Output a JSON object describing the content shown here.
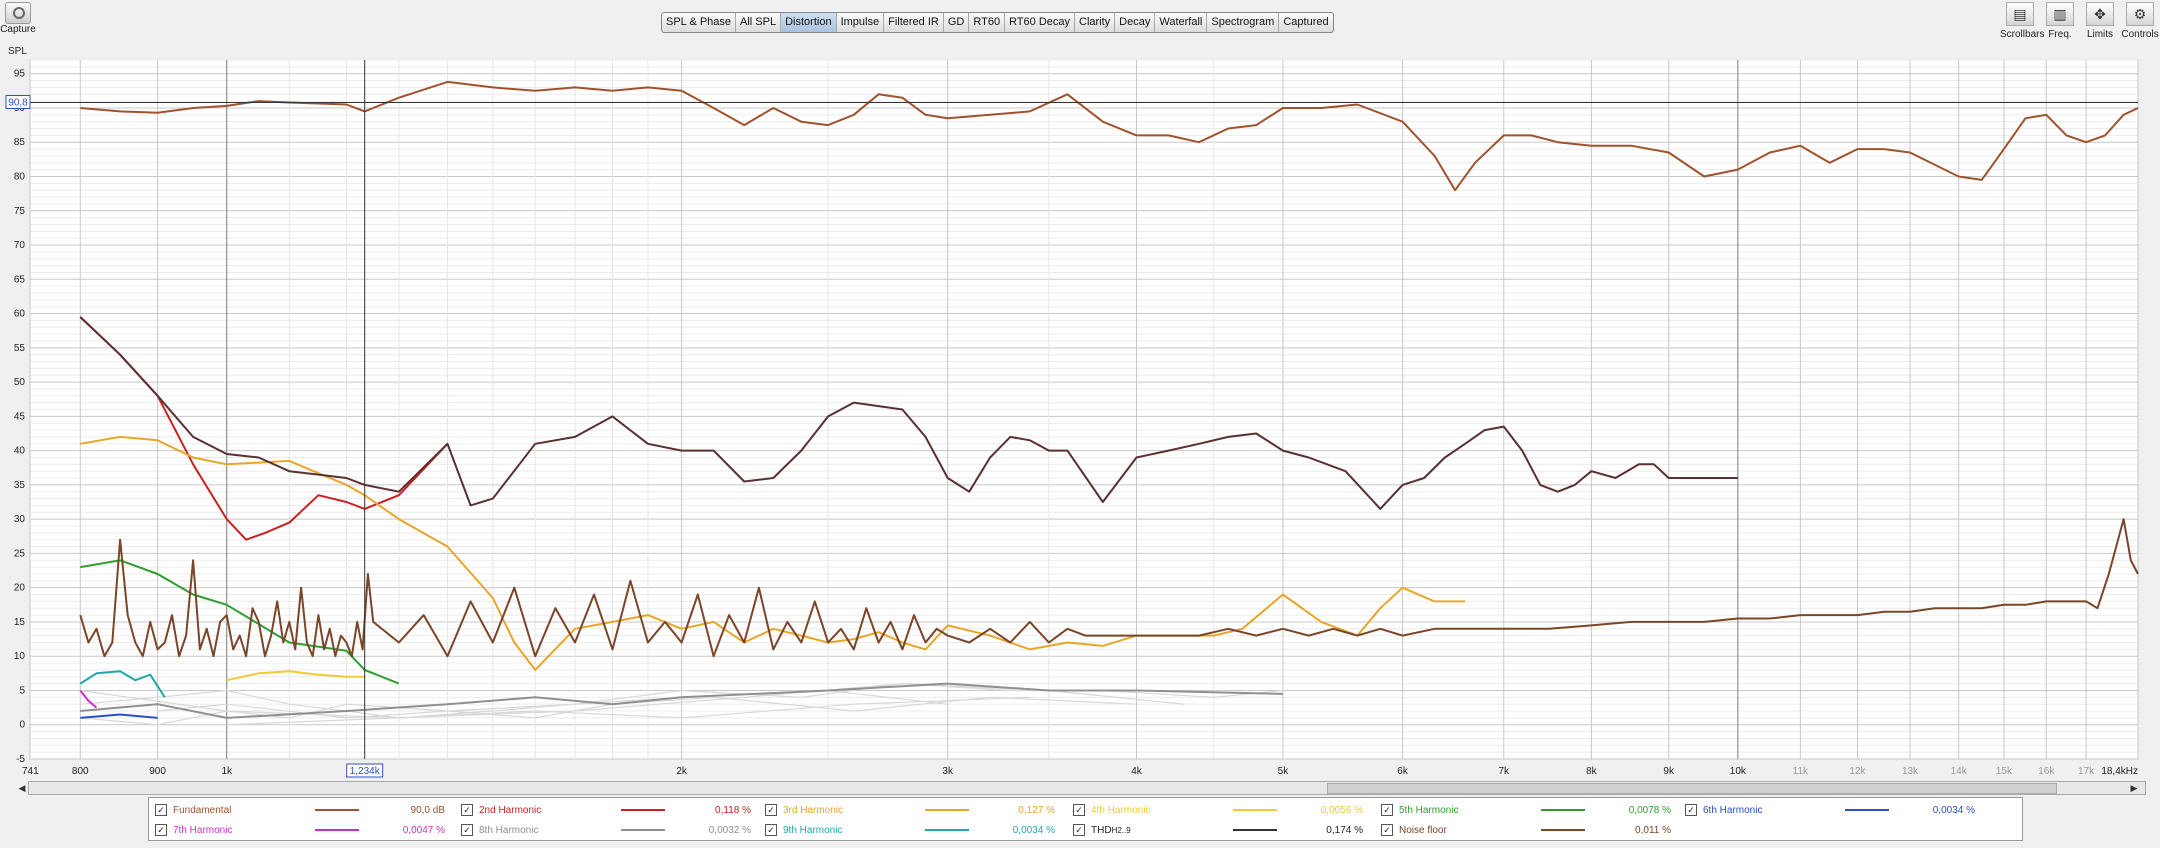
{
  "toolbar": {
    "capture_label": "Capture",
    "tabs": [
      "SPL & Phase",
      "All SPL",
      "Distortion",
      "Impulse",
      "Filtered IR",
      "GD",
      "RT60",
      "RT60 Decay",
      "Clarity",
      "Decay",
      "Waterfall",
      "Spectrogram",
      "Captured"
    ],
    "active_tab": "Distortion",
    "right_buttons": [
      "Scrollbars",
      "Freq. Axis",
      "Limits",
      "Controls"
    ]
  },
  "chart_data": {
    "type": "line",
    "ylabel": "SPL",
    "ylim": [
      -5,
      97
    ],
    "yticks": [
      95,
      90,
      85,
      80,
      75,
      70,
      65,
      60,
      55,
      50,
      45,
      40,
      35,
      30,
      25,
      20,
      15,
      10,
      5,
      0,
      -5
    ],
    "xscale": "log",
    "xlim": [
      741,
      18400
    ],
    "xticks": [
      {
        "v": 741,
        "t": "741"
      },
      {
        "v": 800,
        "t": "800"
      },
      {
        "v": 900,
        "t": "900"
      },
      {
        "v": 1000,
        "t": "1k"
      },
      {
        "v": 2000,
        "t": "2k"
      },
      {
        "v": 3000,
        "t": "3k"
      },
      {
        "v": 4000,
        "t": "4k"
      },
      {
        "v": 5000,
        "t": "5k"
      },
      {
        "v": 6000,
        "t": "6k"
      },
      {
        "v": 7000,
        "t": "7k"
      },
      {
        "v": 8000,
        "t": "8k"
      },
      {
        "v": 9000,
        "t": "9k"
      },
      {
        "v": 10000,
        "t": "10k"
      },
      {
        "v": 11000,
        "t": "11k"
      },
      {
        "v": 12000,
        "t": "12k"
      },
      {
        "v": 13000,
        "t": "13k"
      },
      {
        "v": 14000,
        "t": "14k"
      },
      {
        "v": 15000,
        "t": "15k"
      },
      {
        "v": 16000,
        "t": "16k"
      },
      {
        "v": 17000,
        "t": "17k"
      },
      {
        "v": 18400,
        "t": "18,4kHz"
      }
    ],
    "cursor_x_label": "1,234k",
    "cursor_x": 1234,
    "cursor_y_label": "90,8",
    "cursor_y": 90.8,
    "series": [
      {
        "name": "Fundamental",
        "color": "#a0522d",
        "x": [
          800,
          850,
          900,
          950,
          1000,
          1050,
          1100,
          1200,
          1234,
          1300,
          1400,
          1500,
          1600,
          1700,
          1800,
          1900,
          2000,
          2100,
          2200,
          2300,
          2400,
          2500,
          2600,
          2700,
          2800,
          2900,
          3000,
          3200,
          3400,
          3600,
          3800,
          4000,
          4200,
          4400,
          4600,
          4800,
          5000,
          5300,
          5600,
          6000,
          6300,
          6500,
          6700,
          7000,
          7300,
          7600,
          8000,
          8500,
          9000,
          9500,
          10000,
          10500,
          11000,
          11500,
          12000,
          12500,
          13000,
          14000,
          14500,
          15000,
          15500,
          16000,
          16500,
          17000,
          17500,
          18000,
          18400
        ],
        "y": [
          90,
          89.5,
          89.3,
          90,
          90.3,
          91,
          90.8,
          90.5,
          89.5,
          91.5,
          93.8,
          93,
          92.5,
          93,
          92.5,
          93,
          92.5,
          90,
          87.5,
          90,
          88,
          87.5,
          89,
          92,
          91.5,
          89,
          88.5,
          89,
          89.5,
          92,
          88,
          86,
          86,
          85,
          87,
          87.5,
          90,
          90,
          90.5,
          88,
          83,
          78,
          82,
          86,
          86,
          85,
          84.5,
          84.5,
          83.5,
          80,
          81,
          83.5,
          84.5,
          82,
          84,
          84,
          83.5,
          80,
          79.5,
          84,
          88.5,
          89,
          86,
          85,
          86,
          89,
          90
        ]
      },
      {
        "name": "2nd Harmonic",
        "color": "#cc2020",
        "x": [
          800,
          850,
          900,
          950,
          1000,
          1030,
          1060,
          1100,
          1150,
          1200,
          1234,
          1300,
          1400
        ],
        "y": [
          59.5,
          54,
          48,
          38,
          30,
          27,
          28,
          29.5,
          33.5,
          32.5,
          31.5,
          33.5,
          41
        ]
      },
      {
        "name": "3rd Harmonic",
        "color": "#e8a628",
        "x": [
          800,
          850,
          900,
          950,
          1000,
          1100,
          1200,
          1234,
          1300,
          1400,
          1500,
          1550,
          1600,
          1700,
          1800,
          1900,
          2000,
          2100,
          2200,
          2300,
          2400,
          2500,
          2600,
          2700,
          2800,
          2900,
          3000,
          3200,
          3400,
          3600,
          3800,
          4000,
          4500,
          4700,
          5000,
          5300,
          5600,
          5800,
          6000,
          6300,
          6600
        ],
        "y": [
          41,
          42,
          41.5,
          39,
          38,
          38.5,
          35,
          33.5,
          30,
          26,
          18.5,
          12,
          8,
          14,
          15,
          16,
          14,
          15,
          12,
          14,
          13,
          12,
          12.5,
          13.5,
          12,
          11,
          14.5,
          13,
          11,
          12,
          11.5,
          13,
          13,
          14,
          19,
          15,
          13,
          17,
          20,
          18,
          18
        ]
      },
      {
        "name": "4th Harmonic",
        "color": "#f0c838",
        "x": [
          1000,
          1050,
          1100,
          1150,
          1200,
          1234
        ],
        "y": [
          6.5,
          7.5,
          7.8,
          7.3,
          7,
          7
        ]
      },
      {
        "name": "5th Harmonic",
        "color": "#2e9e2e",
        "x": [
          800,
          850,
          900,
          950,
          1000,
          1100,
          1200,
          1234,
          1300
        ],
        "y": [
          23,
          24,
          22,
          19,
          17.5,
          12,
          10.8,
          8,
          6
        ]
      },
      {
        "name": "6th Harmonic",
        "color": "#2a50c8",
        "x": [
          800,
          850,
          900
        ],
        "y": [
          1,
          1.5,
          1
        ]
      },
      {
        "name": "7th Harmonic",
        "color": "#cc30cc",
        "x": [
          800,
          810,
          820
        ],
        "y": [
          5,
          3.5,
          2.5
        ]
      },
      {
        "name": "8th Harmonic",
        "color": "#909090",
        "x": [
          800,
          900,
          1000,
          1200,
          1400,
          1600,
          1800,
          2000,
          2500,
          3000,
          3500,
          4000,
          5000
        ],
        "y": [
          2,
          3,
          1,
          2,
          3,
          4,
          3,
          4,
          5,
          6,
          5,
          5,
          4.5
        ]
      },
      {
        "name": "9th Harmonic",
        "color": "#20a8a8",
        "x": [
          800,
          820,
          850,
          870,
          890,
          910
        ],
        "y": [
          6,
          7.5,
          7.8,
          6.5,
          7.3,
          4
        ]
      },
      {
        "name": "THD",
        "color": "#5a3030",
        "x": [
          800,
          850,
          900,
          950,
          1000,
          1050,
          1100,
          1150,
          1200,
          1234,
          1300,
          1400,
          1450,
          1500,
          1600,
          1700,
          1800,
          1900,
          2000,
          2100,
          2200,
          2300,
          2400,
          2500,
          2600,
          2700,
          2800,
          2900,
          3000,
          3100,
          3200,
          3300,
          3400,
          3500,
          3600,
          3800,
          4000,
          4200,
          4400,
          4600,
          4800,
          5000,
          5200,
          5500,
          5800,
          6000,
          6200,
          6400,
          6600,
          6800,
          7000,
          7200,
          7400,
          7600,
          7800,
          8000,
          8300,
          8600,
          8800,
          9000,
          9300,
          9600,
          10000
        ],
        "y": [
          59.5,
          54,
          48,
          42,
          39.5,
          39,
          37,
          36.5,
          36,
          35,
          34,
          41,
          32,
          33,
          41,
          42,
          45,
          41,
          40,
          40,
          35.5,
          36,
          40,
          45,
          47,
          46.5,
          46,
          42,
          36,
          34,
          39,
          42,
          41.5,
          40,
          40,
          32.5,
          39,
          40,
          41,
          42,
          42.5,
          40,
          39,
          37,
          31.5,
          35,
          36,
          39,
          41,
          43,
          43.5,
          40,
          35,
          34,
          35,
          37,
          36,
          38,
          38,
          36,
          36,
          36,
          36
        ]
      },
      {
        "name": "Noise floor",
        "color": "#7a4528",
        "x": [
          800,
          810,
          820,
          830,
          840,
          850,
          860,
          870,
          880,
          890,
          900,
          910,
          920,
          930,
          940,
          950,
          960,
          970,
          980,
          990,
          1000,
          1010,
          1020,
          1030,
          1040,
          1050,
          1060,
          1070,
          1080,
          1090,
          1100,
          1110,
          1120,
          1130,
          1140,
          1150,
          1160,
          1170,
          1180,
          1190,
          1200,
          1210,
          1220,
          1230,
          1240,
          1250,
          1300,
          1350,
          1400,
          1450,
          1500,
          1550,
          1600,
          1650,
          1700,
          1750,
          1800,
          1850,
          1900,
          1950,
          2000,
          2050,
          2100,
          2150,
          2200,
          2250,
          2300,
          2350,
          2400,
          2450,
          2500,
          2550,
          2600,
          2650,
          2700,
          2750,
          2800,
          2850,
          2900,
          2950,
          3000,
          3100,
          3200,
          3300,
          3400,
          3500,
          3600,
          3700,
          3800,
          3900,
          4000,
          4200,
          4400,
          4600,
          4800,
          5000,
          5200,
          5400,
          5600,
          5800,
          6000,
          6300,
          6600,
          7000,
          7500,
          8000,
          8500,
          9000,
          9500,
          10000,
          10500,
          11000,
          11500,
          12000,
          12500,
          13000,
          13500,
          14000,
          14500,
          15000,
          15500,
          16000,
          16500,
          17000,
          17300,
          17600,
          17800,
          18000,
          18200,
          18400
        ],
        "y": [
          16,
          12,
          14,
          10,
          12,
          27,
          16,
          12,
          10,
          15,
          11,
          12,
          16,
          10,
          13,
          24,
          11,
          14,
          10,
          15,
          16,
          11,
          13,
          10,
          17,
          15,
          10,
          13,
          18,
          12,
          15,
          11,
          20,
          12,
          10,
          16,
          11,
          14,
          10,
          13,
          12,
          10,
          15,
          11,
          22,
          15,
          12,
          16,
          10,
          18,
          12,
          20,
          10,
          17,
          12,
          19,
          11,
          21,
          12,
          15,
          12,
          19,
          10,
          16,
          12,
          20,
          11,
          15,
          12,
          18,
          12,
          14,
          11,
          17,
          12,
          15,
          11,
          16,
          12,
          14,
          13,
          12,
          14,
          12,
          15,
          12,
          14,
          13,
          13,
          13,
          13,
          13,
          13,
          14,
          13,
          14,
          13,
          14,
          13,
          14,
          13,
          14,
          14,
          14,
          14,
          14.5,
          15,
          15,
          15,
          15.5,
          15.5,
          16,
          16,
          16,
          16.5,
          16.5,
          17,
          17,
          17,
          17.5,
          17.5,
          18,
          18,
          18,
          17,
          22,
          26,
          30,
          24,
          22
        ]
      }
    ],
    "ghost_series": [
      {
        "x": [
          800,
          900,
          1000,
          1100,
          1200,
          1300,
          1500,
          1700,
          2000,
          2500,
          3000
        ],
        "y": [
          3,
          4,
          5,
          3,
          2,
          1,
          2,
          3,
          4,
          5,
          3
        ]
      },
      {
        "x": [
          800,
          900,
          1000,
          1100,
          1200,
          1400,
          1600,
          1800,
          2100,
          2600,
          3200,
          4000
        ],
        "y": [
          1,
          0,
          2,
          1,
          3,
          2,
          1,
          3,
          4,
          2,
          4,
          3
        ]
      },
      {
        "x": [
          900,
          1000,
          1200,
          1400,
          1700,
          2000,
          2400,
          2800,
          3300,
          3800,
          4500,
          5000
        ],
        "y": [
          2,
          3,
          1,
          2,
          3,
          5,
          4,
          6,
          5,
          5,
          4,
          5
        ]
      },
      {
        "x": [
          800,
          1000,
          1300,
          1600,
          2000,
          2600,
          3400
        ],
        "y": [
          5,
          2,
          1,
          2,
          1,
          3,
          4
        ]
      },
      {
        "x": [
          1000,
          1300,
          1700,
          2200,
          2800,
          3500,
          4300
        ],
        "y": [
          0,
          1,
          2,
          4,
          6,
          5,
          3
        ]
      }
    ]
  },
  "legend": [
    {
      "label": "Fundamental",
      "value": "90,0 dB",
      "color": "#a0522d",
      "checked": true
    },
    {
      "label": "2nd Harmonic",
      "value": "0,118 %",
      "color": "#cc2020",
      "checked": true
    },
    {
      "label": "3rd Harmonic",
      "value": "0,127 %",
      "color": "#e8a628",
      "checked": true
    },
    {
      "label": "4th Harmonic",
      "value": "0,0056 %",
      "color": "#f0c838",
      "checked": true
    },
    {
      "label": "5th Harmonic",
      "value": "0,0078 %",
      "color": "#2e9e2e",
      "checked": true
    },
    {
      "label": "6th Harmonic",
      "value": "0,0034 %",
      "color": "#2a50c8",
      "checked": true
    },
    {
      "label": "7th Harmonic",
      "value": "0,0047 %",
      "color": "#cc30cc",
      "checked": true
    },
    {
      "label": "8th Harmonic",
      "value": "0,0032 %",
      "color": "#909090",
      "checked": true
    },
    {
      "label": "9th Harmonic",
      "value": "0,0034 %",
      "color": "#20a8a8",
      "checked": true
    },
    {
      "label": "THD",
      "sub": "H2..9",
      "value": "0,174 %",
      "color": "#333333",
      "checked": true
    },
    {
      "label": "Noise floor",
      "value": "0,011 %",
      "color": "#7a4528",
      "checked": true
    }
  ]
}
